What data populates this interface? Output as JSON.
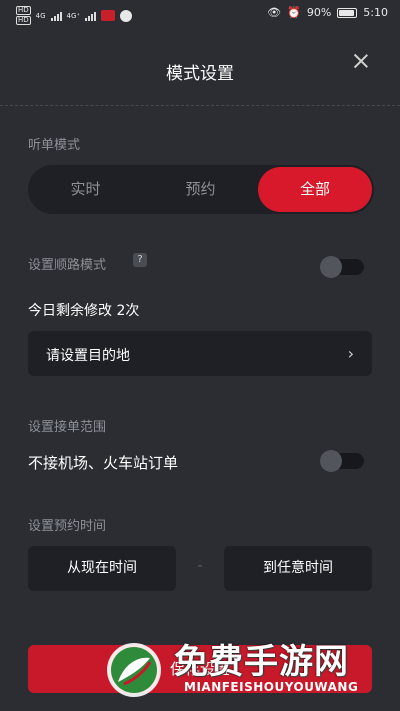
{
  "status_bar": {
    "sim1": "HD",
    "sim2": "HD",
    "network1": "4G",
    "network2": "4G⁺",
    "battery_text": "90%",
    "battery_level": 0.9,
    "time": "5:10"
  },
  "header": {
    "title": "模式设置"
  },
  "order_mode": {
    "label": "听单模式",
    "options": [
      "实时",
      "预约",
      "全部"
    ],
    "selected_index": 2
  },
  "route_mode": {
    "label": "设置顺路模式",
    "help": "?",
    "enabled": false,
    "remaining_text": "今日剩余修改 2次",
    "destination_placeholder": "请设置目的地",
    "chevron": "›"
  },
  "range": {
    "label": "设置接单范围",
    "option_text": "不接机场、火车站订单",
    "enabled": false
  },
  "reservation_time": {
    "label": "设置预约时间",
    "from_label": "从现在时间",
    "separator": "-",
    "to_label": "到任意时间"
  },
  "save_button": {
    "label": "保存设置"
  },
  "watermark": {
    "title": "免费手游网",
    "subtitle": "MIANFEISHOUYOUWANG"
  },
  "colors": {
    "background": "#2b2d33",
    "accent": "#d8192b",
    "card": "#1e2025",
    "muted_text": "#8d9097"
  }
}
